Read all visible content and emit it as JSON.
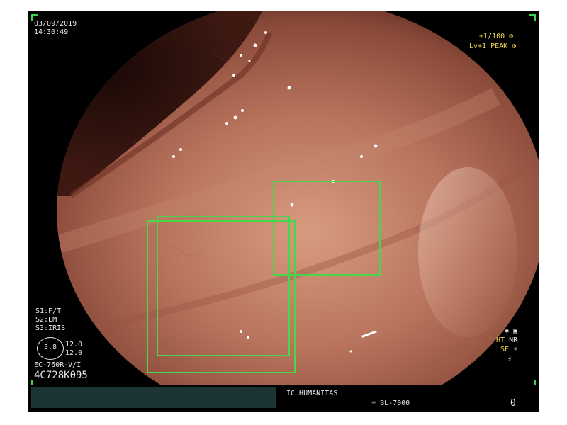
{
  "overlay": {
    "date": "03/09/2019",
    "time": "14:30:49",
    "enhancement": "+1/100",
    "level": "Lv+1",
    "peak": "PEAK",
    "settings": [
      "S1:F/T",
      "S2:LM",
      "S3:IRIS"
    ],
    "circle_value": "3.8",
    "scale_top": "12.0",
    "scale_bottom": "12.0",
    "scope_model": "EC-760R-V/I",
    "scope_code": "4C728K095",
    "ht_label": "HT",
    "nr_label": "NR",
    "se_label": "SE",
    "institution": "IC HUMANITAS",
    "light_source": "BL-7000",
    "counter": "0"
  },
  "colors": {
    "frame": "#000000",
    "detection_box": "#46d84a",
    "overlay_text": "#e8e8e8",
    "overlay_highlight": "#e8d24a",
    "status_bar": "#1c3434"
  }
}
